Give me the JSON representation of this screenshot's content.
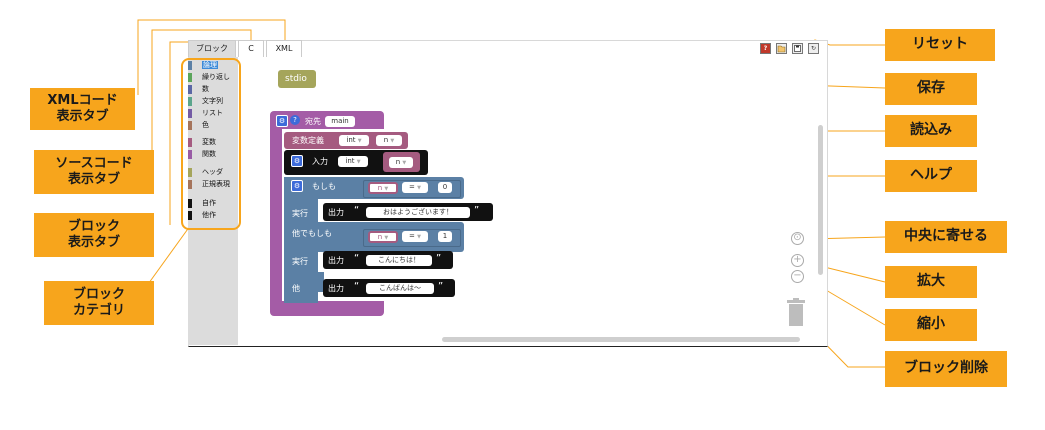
{
  "tabs": [
    {
      "label": "ブロック",
      "active": true
    },
    {
      "label": "C",
      "active": false
    },
    {
      "label": "XML",
      "active": false
    }
  ],
  "categories": [
    {
      "label": "論理",
      "color": "#5b80a5",
      "selected": true
    },
    {
      "label": "繰り返し",
      "color": "#5ba55b"
    },
    {
      "label": "数",
      "color": "#5b67a5"
    },
    {
      "label": "文字列",
      "color": "#5ba58c"
    },
    {
      "label": "リスト",
      "color": "#745ba5"
    },
    {
      "label": "色",
      "color": "#a5745b"
    },
    {
      "label": "変数",
      "color": "#a55b80"
    },
    {
      "label": "関数",
      "color": "#995ba5"
    },
    {
      "label": "ヘッダ",
      "color": "#a5a55b"
    },
    {
      "label": "正規表現",
      "color": "#a5745b"
    },
    {
      "label": "自作",
      "color": "#111111"
    },
    {
      "label": "他作",
      "color": "#111111"
    }
  ],
  "blocks": {
    "header_label": "stdio",
    "main_label": "宛先",
    "main_name": "main",
    "var_def_label": "変数定義",
    "var_type": "int",
    "var_name": "n",
    "input_label": "入力",
    "input_type": "int",
    "input_var": "n",
    "if_label": "もしも",
    "cond_var": "n",
    "cond_op": "=",
    "cond1_value": "0",
    "do_label": "実行",
    "print_label": "出力",
    "msg1": "おはようございます！",
    "elseif_label": "他でもしも",
    "cond2_value": "1",
    "msg2": "こんにちは！",
    "else_label": "他",
    "msg3": "こんばんは〜",
    "quote_open": "“",
    "quote_close": "”",
    "dropdown_arrow": "▼"
  },
  "tools": {
    "help_glyph": "?",
    "reset_glyph": "↻",
    "zoom_in": "+",
    "zoom_out": "−",
    "center": "⊙"
  },
  "annotations": {
    "xml_tab": "XMLコード\n表示タブ",
    "source_tab": "ソースコード\n表示タブ",
    "block_tab": "ブロック\n表示タブ",
    "block_category": "ブロック\nカテゴリ",
    "reset": "リセット",
    "save": "保存",
    "load": "読込み",
    "help": "ヘルプ",
    "center": "中央に寄せる",
    "zoom_in": "拡大",
    "zoom_out": "縮小",
    "delete": "ブロック削除"
  },
  "colors": {
    "annotation": "#f7a51c",
    "function_block": "#a45ca6",
    "variable_block": "#a55b80",
    "logic_block": "#5b80a5",
    "io_block": "#111111",
    "header_block": "#a5a55b"
  }
}
